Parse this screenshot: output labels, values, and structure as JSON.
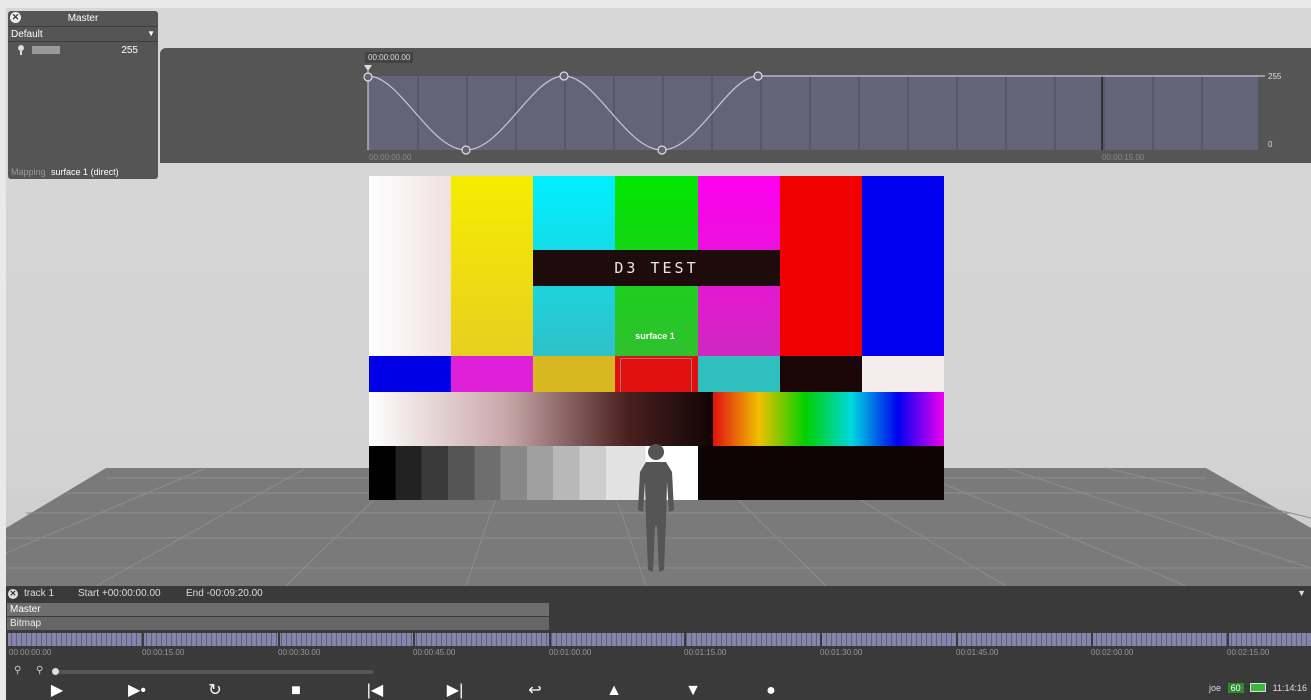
{
  "master": {
    "title": "Master",
    "preset": "Default",
    "level_value": "255",
    "mapping_label": "Mapping",
    "mapping_value": "surface 1 (direct)"
  },
  "curve": {
    "timecode": "00:00:00.00",
    "start_tick": "00:00:00.00",
    "mid_tick": "00:00:15.00",
    "max_label": "255",
    "min_label": "0"
  },
  "card": {
    "title": "D3 TEST",
    "surface_label": "surface 1"
  },
  "track": {
    "name": "track 1",
    "start": "Start +00:00:00.00",
    "end": "End -00:09:20.00",
    "layers": [
      "Master",
      "Bitmap"
    ],
    "ruler_labels": [
      "00:00:00.00",
      "00:00:15.00",
      "00:00:30.00",
      "00:00:45.00",
      "00:01:00.00",
      "00:01:15.00",
      "00:01:30.00",
      "00:01:45.00",
      "00:02:00.00",
      "00:02:15.00"
    ]
  },
  "transport": {
    "icons": [
      "play-icon",
      "play-to-end-icon",
      "loop-play-icon",
      "stop-icon",
      "previous-icon",
      "next-icon",
      "return-icon",
      "up-arrow-icon",
      "down-arrow-icon",
      "record-icon"
    ],
    "glyphs": [
      "▶",
      "▶•",
      "↻",
      "■",
      "|◀",
      "▶|",
      "↩",
      "▲",
      "▼",
      "●"
    ]
  },
  "status": {
    "user": "joe",
    "fps": "60",
    "clock": "11:14:16"
  },
  "colors": {
    "panel": "#555555",
    "timeline": "#3a3a3a",
    "curve_track": "#646478"
  }
}
